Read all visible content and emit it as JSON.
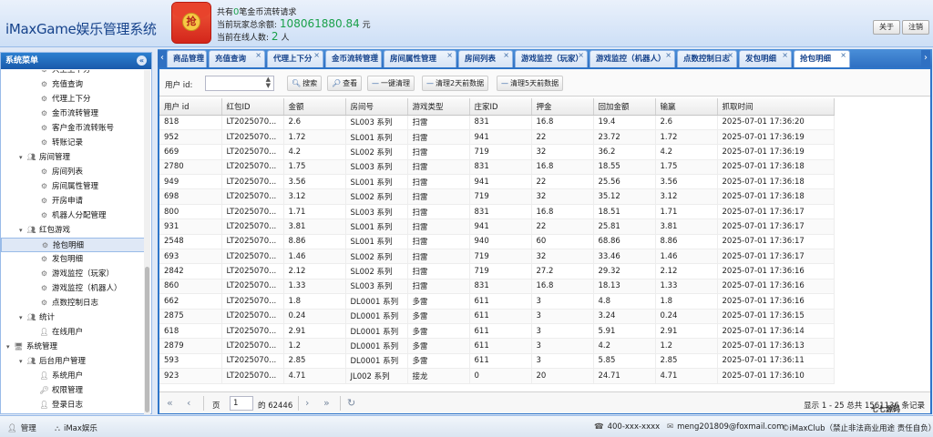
{
  "app": {
    "title": "iMaxGame娱乐管理系统"
  },
  "header": {
    "line1_pre": "共有",
    "line1_count": "0",
    "line1_post": "笔金币流转请求",
    "line2_pre": "当前玩家总余额:",
    "line2_value": "108061880.84",
    "line2_post": "元",
    "line3_pre": "当前在线人数:",
    "line3_value": "2",
    "line3_post": "人",
    "redpacket_char": "抢",
    "about_label": "关于",
    "logout_label": "注销"
  },
  "sidebar": {
    "title": "系统菜单",
    "items": [
      {
        "label": "大王上下分",
        "level": 2,
        "icon": "gear"
      },
      {
        "label": "充值查询",
        "level": 2,
        "icon": "gear"
      },
      {
        "label": "代理上下分",
        "level": 2,
        "icon": "gear"
      },
      {
        "label": "金币流转管理",
        "level": 2,
        "icon": "gear"
      },
      {
        "label": "客户金币流转账号",
        "level": 2,
        "icon": "gears"
      },
      {
        "label": "转账记录",
        "level": 2,
        "icon": "gear"
      },
      {
        "label": "房间管理",
        "level": 1,
        "icon": "users"
      },
      {
        "label": "房间列表",
        "level": 2,
        "icon": "gear"
      },
      {
        "label": "房间属性管理",
        "level": 2,
        "icon": "gear"
      },
      {
        "label": "开房申请",
        "level": 2,
        "icon": "gear"
      },
      {
        "label": "机器人分配管理",
        "level": 2,
        "icon": "gear"
      },
      {
        "label": "红包游戏",
        "level": 1,
        "icon": "users"
      },
      {
        "label": "抢包明细",
        "level": 2,
        "icon": "gear",
        "selected": true
      },
      {
        "label": "发包明细",
        "level": 2,
        "icon": "gear"
      },
      {
        "label": "游戏监控（玩家）",
        "level": 2,
        "icon": "gear"
      },
      {
        "label": "游戏监控（机器人）",
        "level": 2,
        "icon": "gear"
      },
      {
        "label": "点数控制日志",
        "level": 2,
        "icon": "gear"
      },
      {
        "label": "统计",
        "level": 1,
        "icon": "users"
      },
      {
        "label": "在线用户",
        "level": 2,
        "icon": "user"
      },
      {
        "label": "系统管理",
        "level": 0,
        "icon": "monitor"
      },
      {
        "label": "后台用户管理",
        "level": 1,
        "icon": "users"
      },
      {
        "label": "系统用户",
        "level": 2,
        "icon": "user"
      },
      {
        "label": "权限管理",
        "level": 2,
        "icon": "key"
      },
      {
        "label": "登录日志",
        "level": 2,
        "icon": "user"
      }
    ]
  },
  "tabs": [
    {
      "label": "商品管理"
    },
    {
      "label": "充值查询"
    },
    {
      "label": "代理上下分"
    },
    {
      "label": "金币流转管理"
    },
    {
      "label": "房间属性管理"
    },
    {
      "label": "房间列表"
    },
    {
      "label": "游戏监控（玩家）"
    },
    {
      "label": "游戏监控（机器人）"
    },
    {
      "label": "点数控制日志"
    },
    {
      "label": "发包明细"
    },
    {
      "label": "抢包明细",
      "active": true
    }
  ],
  "toolbar": {
    "userid_label": "用户 id:",
    "search_label": "搜索",
    "view_label": "查看",
    "clear_all_label": "一键清理",
    "clear2_label": "清理2天前数据",
    "clear5_label": "清理5天前数据"
  },
  "table": {
    "columns": [
      "用户 id",
      "红包ID",
      "金额",
      "房间号",
      "游戏类型",
      "庄家ID",
      "押金",
      "回加金额",
      "输赢",
      "抓取时间"
    ],
    "rows": [
      [
        "818",
        "LT2025070...",
        "2.6",
        "SL003 系列",
        "扫雷",
        "831",
        "16.8",
        "19.4",
        "2.6",
        "2025-07-01 17:36:20"
      ],
      [
        "952",
        "LT2025070...",
        "1.72",
        "SL001 系列",
        "扫雷",
        "941",
        "22",
        "23.72",
        "1.72",
        "2025-07-01 17:36:19"
      ],
      [
        "669",
        "LT2025070...",
        "4.2",
        "SL002 系列",
        "扫雷",
        "719",
        "32",
        "36.2",
        "4.2",
        "2025-07-01 17:36:19"
      ],
      [
        "2780",
        "LT2025070...",
        "1.75",
        "SL003 系列",
        "扫雷",
        "831",
        "16.8",
        "18.55",
        "1.75",
        "2025-07-01 17:36:18"
      ],
      [
        "949",
        "LT2025070...",
        "3.56",
        "SL001 系列",
        "扫雷",
        "941",
        "22",
        "25.56",
        "3.56",
        "2025-07-01 17:36:18"
      ],
      [
        "698",
        "LT2025070...",
        "3.12",
        "SL002 系列",
        "扫雷",
        "719",
        "32",
        "35.12",
        "3.12",
        "2025-07-01 17:36:18"
      ],
      [
        "800",
        "LT2025070...",
        "1.71",
        "SL003 系列",
        "扫雷",
        "831",
        "16.8",
        "18.51",
        "1.71",
        "2025-07-01 17:36:17"
      ],
      [
        "931",
        "LT2025070...",
        "3.81",
        "SL001 系列",
        "扫雷",
        "941",
        "22",
        "25.81",
        "3.81",
        "2025-07-01 17:36:17"
      ],
      [
        "2548",
        "LT2025070...",
        "8.86",
        "SL001 系列",
        "扫雷",
        "940",
        "60",
        "68.86",
        "8.86",
        "2025-07-01 17:36:17"
      ],
      [
        "693",
        "LT2025070...",
        "1.46",
        "SL002 系列",
        "扫雷",
        "719",
        "32",
        "33.46",
        "1.46",
        "2025-07-01 17:36:17"
      ],
      [
        "2842",
        "LT2025070...",
        "2.12",
        "SL002 系列",
        "扫雷",
        "719",
        "27.2",
        "29.32",
        "2.12",
        "2025-07-01 17:36:16"
      ],
      [
        "860",
        "LT2025070...",
        "1.33",
        "SL003 系列",
        "扫雷",
        "831",
        "16.8",
        "18.13",
        "1.33",
        "2025-07-01 17:36:16"
      ],
      [
        "662",
        "LT2025070...",
        "1.8",
        "DL0001 系列",
        "多雷",
        "611",
        "3",
        "4.8",
        "1.8",
        "2025-07-01 17:36:16"
      ],
      [
        "2875",
        "LT2025070...",
        "0.24",
        "DL0001 系列",
        "多雷",
        "611",
        "3",
        "3.24",
        "0.24",
        "2025-07-01 17:36:15"
      ],
      [
        "618",
        "LT2025070...",
        "2.91",
        "DL0001 系列",
        "多雷",
        "611",
        "3",
        "5.91",
        "2.91",
        "2025-07-01 17:36:14"
      ],
      [
        "2879",
        "LT2025070...",
        "1.2",
        "DL0001 系列",
        "多雷",
        "611",
        "3",
        "4.2",
        "1.2",
        "2025-07-01 17:36:13"
      ],
      [
        "593",
        "LT2025070...",
        "2.85",
        "DL0001 系列",
        "多雷",
        "611",
        "3",
        "5.85",
        "2.85",
        "2025-07-01 17:36:11"
      ],
      [
        "923",
        "LT2025070...",
        "4.71",
        "JL002 系列",
        "接龙",
        "0",
        "20",
        "24.71",
        "4.71",
        "2025-07-01 17:36:10"
      ]
    ]
  },
  "pager": {
    "page_label": "页",
    "page_value": "1",
    "of_label": "的 62446",
    "display": "显示 1 - 25 总共 1561136 条记录"
  },
  "footer": {
    "admin_label": "管理",
    "org_label": "iMax娱乐",
    "phone": "400-xxx-xxxx",
    "email": "meng201809@foxmail.com",
    "copyright": "©iMaxClub（禁止非法商业用途 责任自负）"
  },
  "watermark": "七七源码"
}
